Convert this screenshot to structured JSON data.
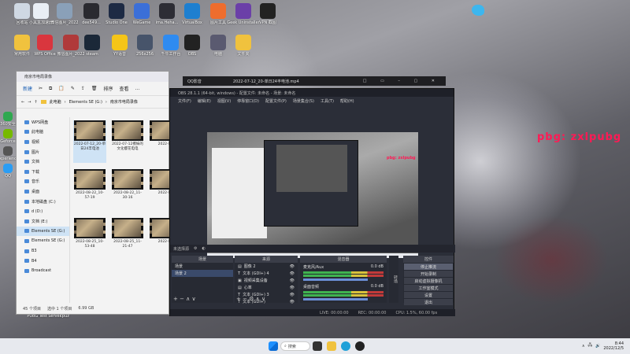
{
  "desktop": {
    "icons": [
      {
        "label": "回收站",
        "color": "#cfd8e3"
      },
      {
        "label": "小黑盒加速器",
        "color": "#e9eef5"
      },
      {
        "label": "微信图片_2022",
        "color": "#8aa0b8"
      },
      {
        "label": "dee549...",
        "color": "#2a2a30"
      },
      {
        "label": "Studio One",
        "color": "#1d2a44"
      },
      {
        "label": "WeGame",
        "color": "#3b6fd8"
      },
      {
        "label": "ima.Heha...",
        "color": "#2d2d35"
      },
      {
        "label": "VirtualBox",
        "color": "#1e7fd0"
      },
      {
        "label": "图片工具",
        "color": "#ee6d2e"
      },
      {
        "label": "Geek Uninstaller",
        "color": "#6b3fa8"
      },
      {
        "label": "VPN 截图",
        "color": "#222"
      },
      {
        "label": "常用软件",
        "color": "#f0c23e"
      },
      {
        "label": "WPS Office",
        "color": "#d9363e"
      },
      {
        "label": "微信图片_2022",
        "color": "#b03a3a"
      },
      {
        "label": "steam",
        "color": "#1b2838"
      },
      {
        "label": "YY语音",
        "color": "#f5c518"
      },
      {
        "label": "256x256",
        "color": "#47546a"
      },
      {
        "label": "千牛工作台",
        "color": "#2f8bf0"
      },
      {
        "label": "OBS",
        "color": "#222"
      },
      {
        "label": "电脑",
        "color": "#5a5a70"
      },
      {
        "label": "文件夹",
        "color": "#f0c23e"
      }
    ],
    "left_icons": [
      {
        "label": "360安全",
        "color": "#2fa84f"
      },
      {
        "label": "Geforce",
        "color": "#76b900"
      },
      {
        "label": "Experience",
        "color": "#555"
      },
      {
        "label": "QQ",
        "color": "#2a9df4"
      }
    ],
    "bottom_icons": [
      {
        "label": "PUBG Test Server",
        "color": "#9a8a5a"
      },
      {
        "label": "cpuz",
        "color": "#d8d8d8"
      }
    ],
    "overlay_text": "pbg: zxlpubg",
    "overlay_color": "#ff1a55"
  },
  "explorer": {
    "title": "南京市电局录像",
    "toolbar": [
      "新建",
      "排序",
      "查看",
      "..."
    ],
    "path": [
      "此电脑",
      "Elements SE (G:)",
      "南京市电局录像"
    ],
    "sidebar": [
      {
        "label": "WPS网盘",
        "selected": false
      },
      {
        "label": "此电脑",
        "selected": false
      },
      {
        "label": "视频",
        "selected": false
      },
      {
        "label": "图片",
        "selected": false
      },
      {
        "label": "文档",
        "selected": false
      },
      {
        "label": "下载",
        "selected": false
      },
      {
        "label": "音乐",
        "selected": false
      },
      {
        "label": "桌面",
        "selected": false
      },
      {
        "label": "本地磁盘 (C:)",
        "selected": false
      },
      {
        "label": "d (D:)",
        "selected": false
      },
      {
        "label": "文档 (E:)",
        "selected": false
      },
      {
        "label": "Elements SE (G:)",
        "selected": true
      },
      {
        "label": "Elements SE (G:)",
        "selected": false
      },
      {
        "label": "B3",
        "selected": false
      },
      {
        "label": "B4",
        "selected": false
      },
      {
        "label": "Broadcast",
        "selected": false
      }
    ],
    "files": [
      "2022-07-12_20-单日24丰电池",
      "2022-07-12撩妹的文化樱花电电",
      "2022-07",
      "2022-08-22_10-57-19",
      "2022-08-22_11-30-16",
      "2022-08",
      "2022-08-25_10-53-48",
      "2022-08-25_11-21-47",
      "2022-08"
    ],
    "status": {
      "count": "45 个项目",
      "selected": "选中 1 个项目",
      "size": "6.99 GB"
    }
  },
  "player": {
    "title": "QQ影音",
    "file": "2022-07-12_20-单日24丰电池.mp4"
  },
  "obs": {
    "title": "OBS 28.1.1 (64-bit, windows) - 配置文件: 未命名 - 场景: 未命名",
    "menu": [
      "文件(F)",
      "编辑(E)",
      "视图(V)",
      "停靠窗口(D)",
      "配置文件(P)",
      "场景集合(S)",
      "工具(T)",
      "帮助(H)"
    ],
    "preview_overlay": "pbg: zxlpubg",
    "scene_panel_label": "场景",
    "source_label": "未选择源",
    "scenes": [
      "场景",
      "场景 2"
    ],
    "sources_label": "来源",
    "sources": [
      "图像 2",
      "文本 (GDI+) 4",
      "视频采集设备",
      "心率",
      "文本 (GDI+) 3",
      "文本 (GDI+)"
    ],
    "mixer_label": "混音器",
    "mixer": [
      {
        "name": "麦克风/Aux",
        "db": "0.0 dB"
      },
      {
        "name": "桌面音频",
        "db": "0.0 dB"
      }
    ],
    "controls_label": "控件",
    "controls": [
      "停止推流",
      "开始录制",
      "启动虚拟摄像机",
      "工作室模式",
      "设置",
      "退出"
    ],
    "transitions_label": "转场",
    "status": {
      "live": "LIVE: 00:00:00",
      "rec": "REC: 00:00:00",
      "cpu": "CPU: 1.5%, 60.00 fps"
    }
  },
  "taskbar": {
    "search": "搜索",
    "time": "8:44",
    "date": "2022/12/5"
  }
}
